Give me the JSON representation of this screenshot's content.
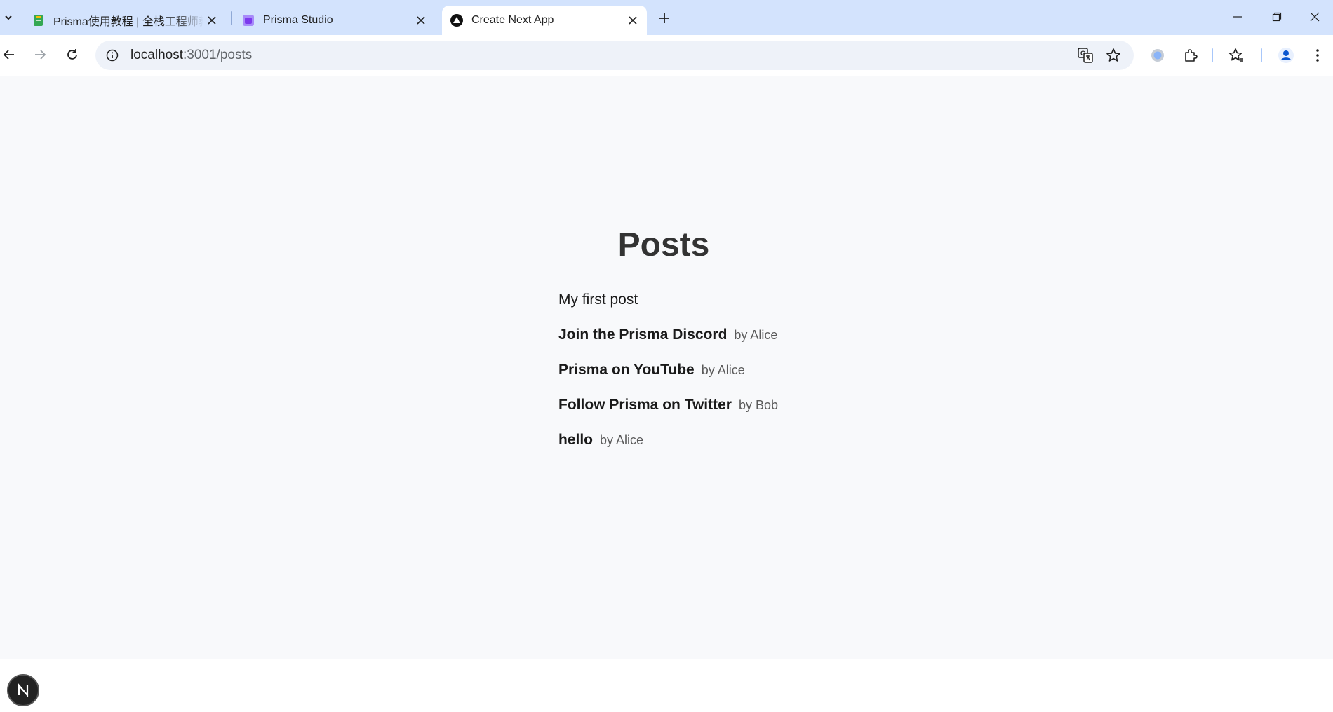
{
  "browser": {
    "tabs": [
      {
        "title": "Prisma使用教程 | 全栈工程师教程",
        "favicon": "book-icon",
        "close": "×"
      },
      {
        "title": "Prisma Studio",
        "favicon": "prisma-studio-icon",
        "close": "×"
      },
      {
        "title": "Create Next App",
        "favicon": "nextjs-triangle-icon",
        "close": "×",
        "active": true
      }
    ],
    "new_tab": "+",
    "address": {
      "host": "localhost",
      "port_path": ":3001/posts"
    }
  },
  "page": {
    "heading": "Posts",
    "posts": [
      {
        "title": "My first post",
        "author": ""
      },
      {
        "title": "Join the Prisma Discord",
        "author": "by Alice"
      },
      {
        "title": "Prisma on YouTube",
        "author": "by Alice"
      },
      {
        "title": "Follow Prisma on Twitter",
        "author": "by Bob"
      },
      {
        "title": "hello",
        "author": "by Alice"
      }
    ],
    "badge": "N"
  },
  "colors": {
    "tabstrip": "#d3e3fd",
    "omnibox": "#eef2f9",
    "page_bg": "#f8f9fb",
    "heading": "#333333"
  }
}
